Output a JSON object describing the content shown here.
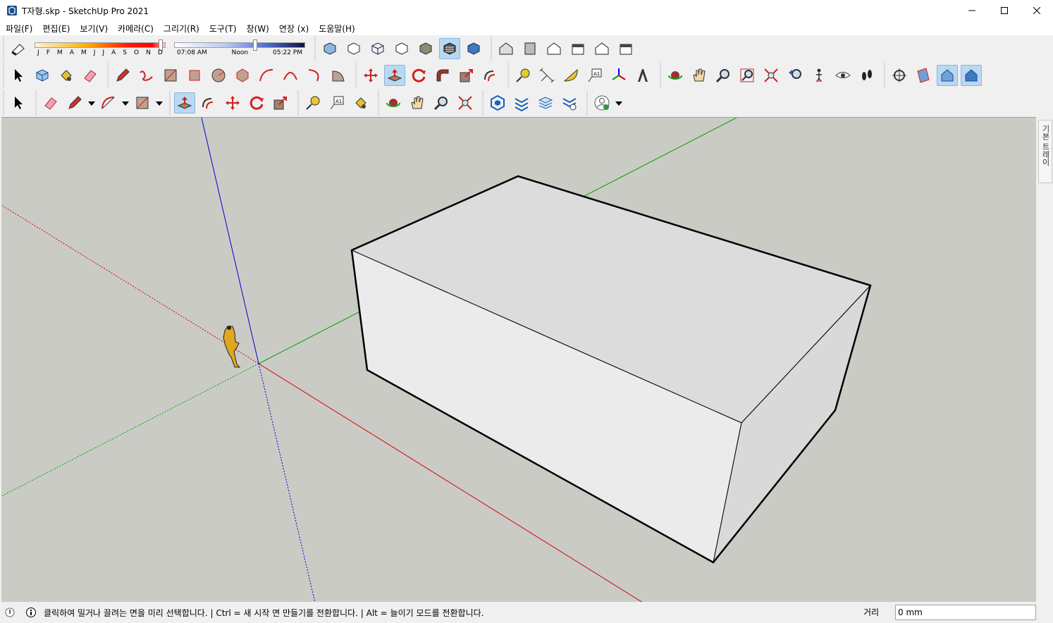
{
  "window": {
    "title": "T자형.skp - SketchUp Pro 2021",
    "minimize_icon": "minimize-icon",
    "maximize_icon": "maximize-icon",
    "close_icon": "close-icon"
  },
  "menu": {
    "items": [
      "파일(F)",
      "편집(E)",
      "보기(V)",
      "카메라(C)",
      "그리기(R)",
      "도구(T)",
      "창(W)",
      "연장 (x)",
      "도움말(H)"
    ]
  },
  "shadows": {
    "months": [
      "J",
      "F",
      "M",
      "A",
      "M",
      "J",
      "J",
      "A",
      "S",
      "O",
      "N",
      "D"
    ],
    "time_start": "07:08 AM",
    "time_mid": "Noon",
    "time_end": "05:22 PM",
    "month_position": 0.98,
    "time_position": 0.62
  },
  "tray": {
    "tab_label": "기본 트레이"
  },
  "status": {
    "message": "클릭하여 밀거나 끌려는 면을 미리 선택합니다. | Ctrl = 새 시작 면 만들기를 전환합니다. | Alt = 늘이기 모드를 전환합니다.",
    "measurement_label": "거리",
    "measurement_value": "0 mm"
  },
  "colors": {
    "viewport_bg": "#cbcbc5",
    "axis_red": "#d00000",
    "axis_green": "#00a000",
    "axis_blue": "#0000d0",
    "active_tool": "#b9d8f1"
  }
}
